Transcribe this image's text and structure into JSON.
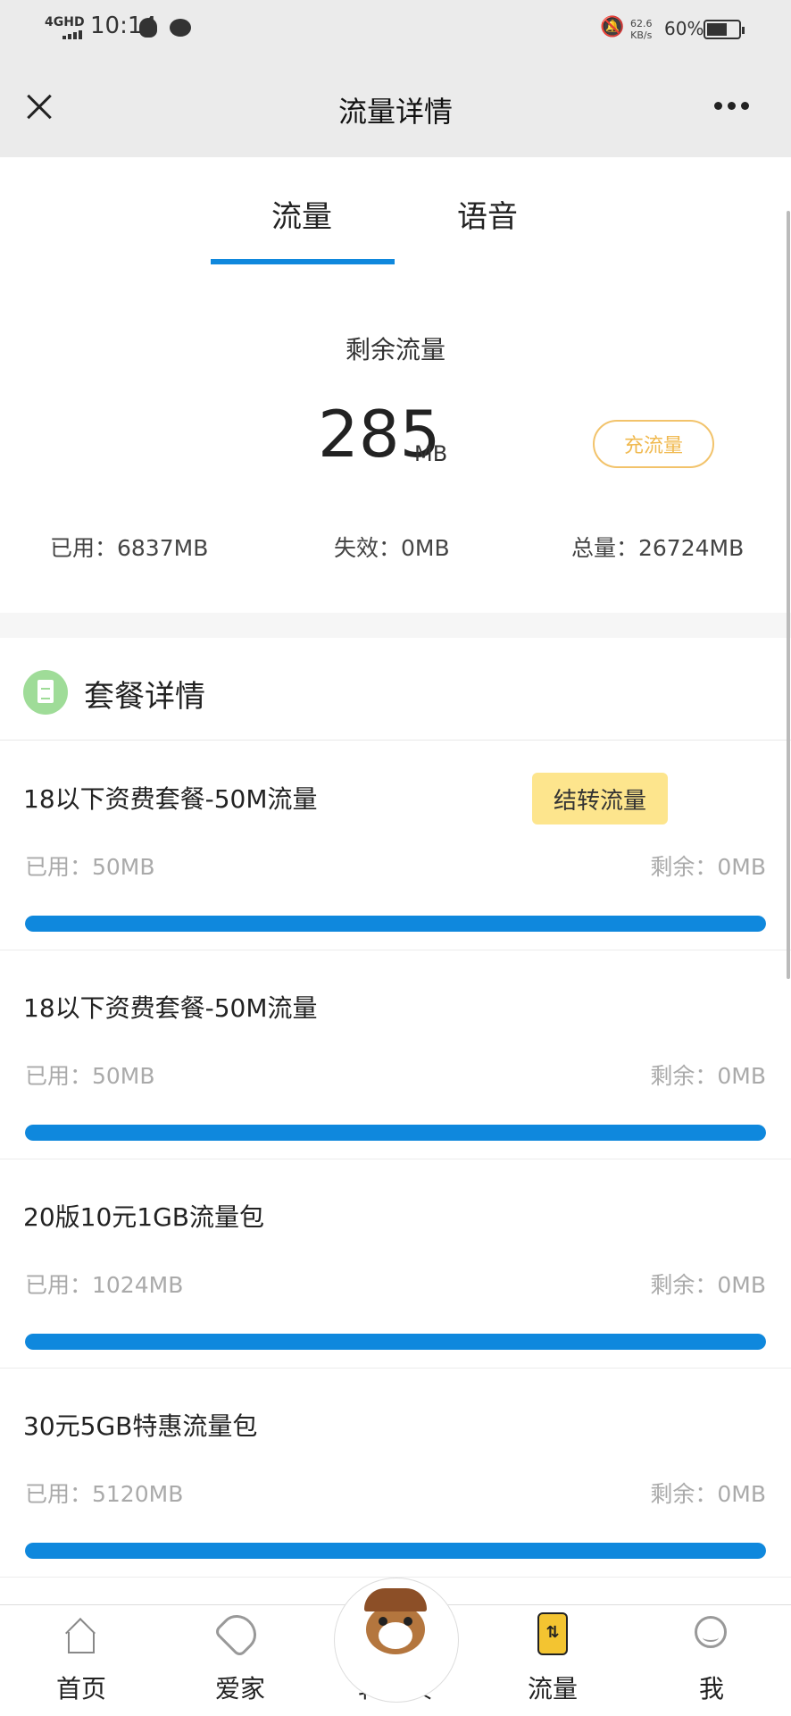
{
  "status_bar": {
    "network": "4GHD",
    "time": "10:14",
    "speed_value": "62.6",
    "speed_unit": "KB/s",
    "battery": "60%"
  },
  "header": {
    "title": "流量详情",
    "close_icon": "close-icon",
    "more_icon": "more-icon"
  },
  "tabs": [
    {
      "label": "流量",
      "active": true
    },
    {
      "label": "语音",
      "active": false
    }
  ],
  "summary": {
    "remain_label": "剩余流量",
    "remain_value": "285",
    "remain_unit": "MB",
    "recharge_label": "充流量",
    "used": "已用：6837MB",
    "invalid": "失效：0MB",
    "total": "总量：26724MB"
  },
  "package_section": {
    "title": "套餐详情",
    "icon": "document-icon",
    "transfer_label": "结转流量",
    "items": [
      {
        "name": "18以下资费套餐-50M流量",
        "used": "已用：50MB",
        "remain": "剩余：0MB",
        "progress": 1.0
      },
      {
        "name": "18以下资费套餐-50M流量",
        "used": "已用：50MB",
        "remain": "剩余：0MB",
        "progress": 1.0
      },
      {
        "name": "20版10元1GB流量包",
        "used": "已用：1024MB",
        "remain": "剩余：0MB",
        "progress": 1.0
      },
      {
        "name": "30元5GB特惠流量包",
        "used": "已用：5120MB",
        "remain": "剩余：0MB",
        "progress": 1.0
      }
    ]
  },
  "bottom_nav": [
    {
      "label": "首页",
      "icon": "home-icon"
    },
    {
      "label": "爱家",
      "icon": "family-icon"
    },
    {
      "label": "转转贝",
      "icon": "mascot-icon"
    },
    {
      "label": "流量",
      "icon": "flow-icon"
    },
    {
      "label": "我",
      "icon": "profile-icon"
    }
  ],
  "colors": {
    "accent": "#0f88dd",
    "recharge_border": "#f2c36b",
    "transfer_bg": "#fde58d"
  }
}
